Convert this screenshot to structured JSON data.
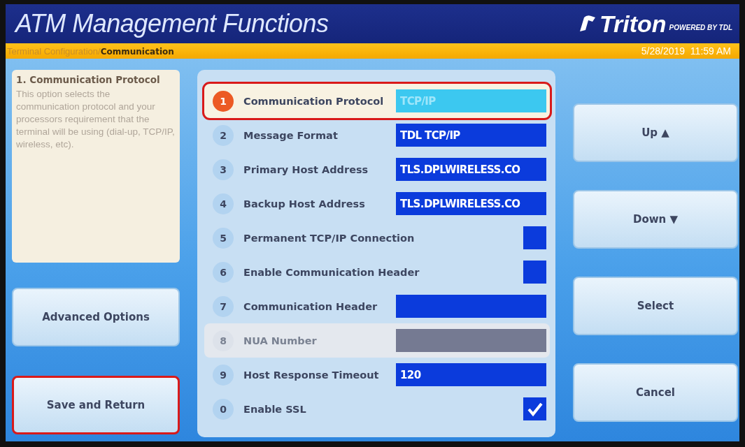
{
  "header": {
    "title": "ATM Management Functions",
    "logo": {
      "brand": "Triton",
      "tagline": "POWERED BY TDL"
    }
  },
  "breadcrumb": {
    "path": "Terminal Configuration/",
    "current": "Communication",
    "datetime": "5/28/2019  11:59 AM"
  },
  "help": {
    "title": "1. Communication Protocol",
    "text": "This option selects the communication protocol and your processors requirement that the terminal will be using (dial-up, TCP/IP, wireless, etc)."
  },
  "left_buttons": [
    {
      "label": "Advanced Options",
      "highlighted": false
    },
    {
      "label": "Save and Return",
      "highlighted": true
    }
  ],
  "options": [
    {
      "number": "1",
      "label": "Communication Protocol",
      "kind": "text",
      "value": "TCP/IP",
      "selected": true,
      "disabled": false,
      "highlighted": true
    },
    {
      "number": "2",
      "label": "Message Format",
      "kind": "text",
      "value": "TDL TCP/IP",
      "selected": false,
      "disabled": false,
      "highlighted": false
    },
    {
      "number": "3",
      "label": "Primary Host Address",
      "kind": "text",
      "value": "TLS.DPLWIRELESS.CO",
      "selected": false,
      "disabled": false,
      "highlighted": false
    },
    {
      "number": "4",
      "label": "Backup Host Address",
      "kind": "text",
      "value": "TLS.DPLWIRELESS.CO",
      "selected": false,
      "disabled": false,
      "highlighted": false
    },
    {
      "number": "5",
      "label": "Permanent TCP/IP Connection",
      "kind": "checkbox",
      "checked": false,
      "selected": false,
      "disabled": false,
      "highlighted": false
    },
    {
      "number": "6",
      "label": "Enable Communication Header",
      "kind": "checkbox",
      "checked": false,
      "selected": false,
      "disabled": false,
      "highlighted": false
    },
    {
      "number": "7",
      "label": "Communication Header",
      "kind": "text",
      "selected": false,
      "disabled": false,
      "highlighted": false
    },
    {
      "number": "8",
      "label": "NUA Number",
      "kind": "text",
      "selected": false,
      "disabled": true,
      "highlighted": false
    },
    {
      "number": "9",
      "label": "Host Response Timeout",
      "kind": "text",
      "value": "120",
      "selected": false,
      "disabled": false,
      "highlighted": false
    },
    {
      "number": "0",
      "label": "Enable SSL",
      "kind": "checkbox",
      "checked": true,
      "selected": false,
      "disabled": false,
      "highlighted": false
    }
  ],
  "right_buttons": [
    {
      "label": "Up",
      "arrow": "▲"
    },
    {
      "label": "Down",
      "arrow": "▼"
    },
    {
      "label": "Select"
    },
    {
      "label": "Cancel"
    }
  ]
}
